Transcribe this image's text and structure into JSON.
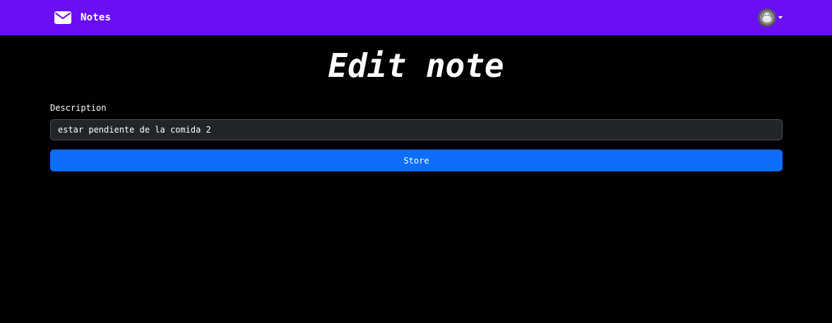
{
  "navbar": {
    "brand_label": "Notes",
    "brand_icon": "envelope-icon",
    "background_color": "#6a0ff3",
    "user_avatar_icon": "user-avatar-icon"
  },
  "page": {
    "title": "Edit note"
  },
  "form": {
    "description_label": "Description",
    "description_value": "estar pendiente de la comida 2",
    "submit_label": "Store",
    "submit_color": "#0d6efd"
  }
}
